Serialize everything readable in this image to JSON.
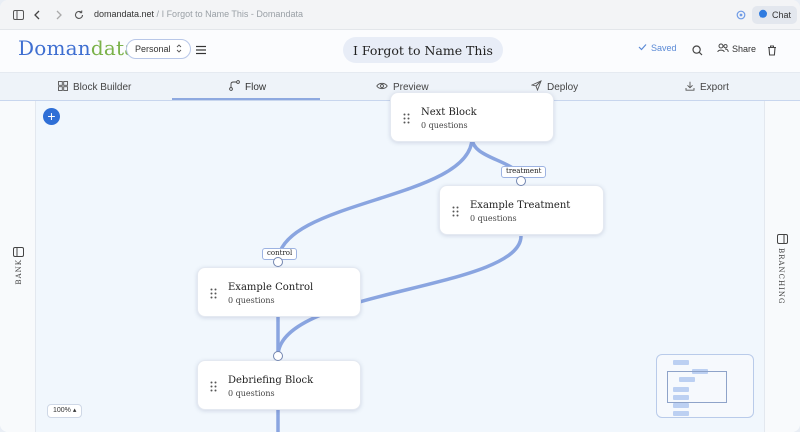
{
  "browser": {
    "domain": "domandata.net",
    "separator": " / ",
    "page_title": "I Forgot to Name This - Domandata",
    "chat_label": "Chat"
  },
  "header": {
    "logo_part1": "Doman",
    "logo_part2": "data",
    "workspace": "Personal",
    "doc_title": "I Forgot to Name This",
    "saved_label": "Saved",
    "share_label": "Share"
  },
  "tabs": [
    {
      "label": "Block Builder",
      "icon": "grid-icon"
    },
    {
      "label": "Flow",
      "icon": "flow-icon"
    },
    {
      "label": "Preview",
      "icon": "eye-icon"
    },
    {
      "label": "Deploy",
      "icon": "send-icon"
    },
    {
      "label": "Export",
      "icon": "download-icon"
    }
  ],
  "side": {
    "left_label": "BANK",
    "right_label": "BRANCHING"
  },
  "nodes": [
    {
      "title": "Next Block",
      "sub": "0 questions"
    },
    {
      "title": "Example Treatment",
      "sub": "0 questions"
    },
    {
      "title": "Example Control",
      "sub": "0 questions"
    },
    {
      "title": "Debriefing Block",
      "sub": "0 questions"
    }
  ],
  "edges": {
    "treatment_label": "treatment",
    "control_label": "control"
  },
  "zoom": "100% ▴",
  "colors": {
    "accent": "#2f6fd6",
    "edge": "#8aa5e0",
    "logo_blue": "#3f6fd1",
    "logo_green": "#7bb24a"
  }
}
